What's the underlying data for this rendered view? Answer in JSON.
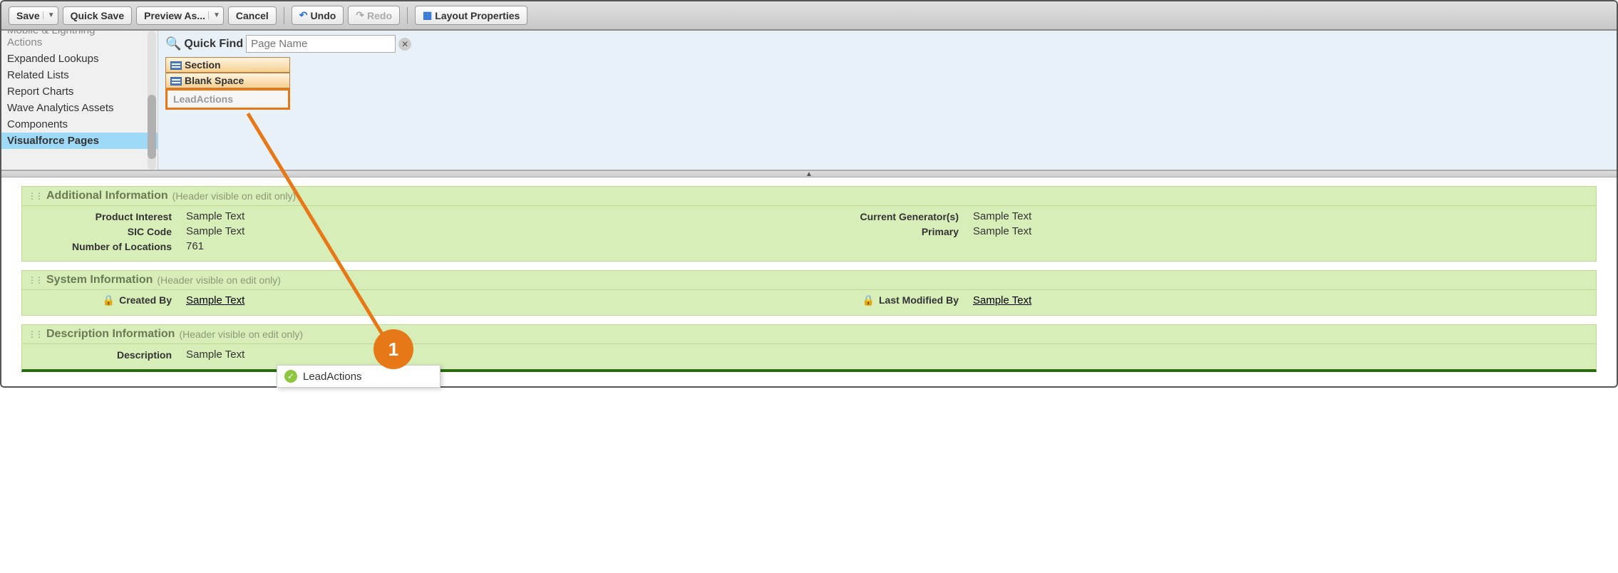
{
  "toolbar": {
    "save": "Save",
    "quick_save": "Quick Save",
    "preview_as": "Preview As...",
    "cancel": "Cancel",
    "undo": "Undo",
    "redo": "Redo",
    "layout_props": "Layout Properties"
  },
  "sidebar": {
    "items": [
      {
        "label": "Mobile & Lightning Actions",
        "cut": true
      },
      {
        "label": "Expanded Lookups"
      },
      {
        "label": "Related Lists"
      },
      {
        "label": "Report Charts"
      },
      {
        "label": "Wave Analytics Assets"
      },
      {
        "label": "Components"
      },
      {
        "label": "Visualforce Pages",
        "selected": true
      }
    ]
  },
  "quickfind": {
    "label": "Quick Find",
    "placeholder": "Page Name"
  },
  "palette": {
    "items": [
      {
        "label": "Section",
        "kind": "section"
      },
      {
        "label": "Blank Space",
        "kind": "blank"
      },
      {
        "label": "LeadActions",
        "kind": "vf",
        "highlight": true
      }
    ]
  },
  "sections": [
    {
      "title": "Additional Information",
      "sub": "(Header visible on edit only)",
      "left": [
        {
          "label": "Product Interest",
          "value": "Sample Text"
        },
        {
          "label": "SIC Code",
          "value": "Sample Text"
        },
        {
          "label": "Number of Locations",
          "value": "761"
        }
      ],
      "right": [
        {
          "label": "Current Generator(s)",
          "value": "Sample Text"
        },
        {
          "label": "Primary",
          "value": "Sample Text"
        }
      ]
    },
    {
      "title": "System Information",
      "sub": "(Header visible on edit only)",
      "left": [
        {
          "label": "Created By",
          "value": "Sample Text",
          "lock": true,
          "link": true
        }
      ],
      "right": [
        {
          "label": "Last Modified By",
          "value": "Sample Text",
          "lock": true,
          "link": true
        }
      ]
    },
    {
      "title": "Description Information",
      "sub": "(Header visible on edit only)",
      "darkline": true,
      "left": [
        {
          "label": "Description",
          "value": "Sample Text"
        }
      ],
      "right": []
    }
  ],
  "annotation": {
    "badge": "1",
    "drop_label": "LeadActions"
  }
}
